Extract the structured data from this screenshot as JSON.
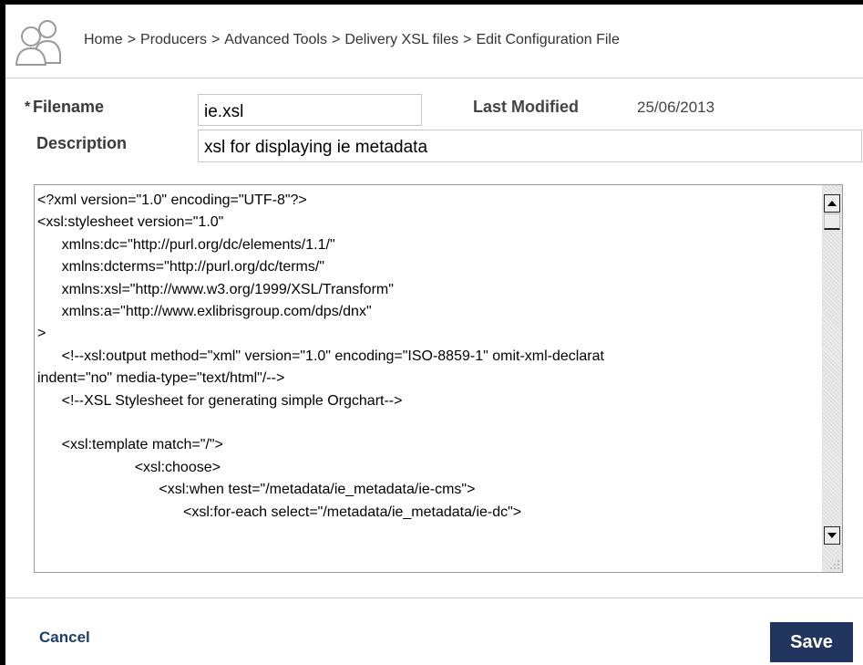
{
  "breadcrumb": {
    "items": [
      "Home",
      "Producers",
      "Advanced Tools",
      "Delivery XSL files",
      "Edit Configuration File"
    ],
    "separator": ">"
  },
  "form": {
    "required_marker": "*",
    "filename_label": "Filename",
    "filename_value": "ie.xsl",
    "last_modified_label": "Last Modified",
    "last_modified_value": "25/06/2013",
    "description_label": "Description",
    "description_value": "xsl for displaying ie metadata"
  },
  "editor": {
    "content": "<?xml version=\"1.0\" encoding=\"UTF-8\"?>\n<xsl:stylesheet version=\"1.0\"\n      xmlns:dc=\"http://purl.org/dc/elements/1.1/\"\n      xmlns:dcterms=\"http://purl.org/dc/terms/\"\n      xmlns:xsl=\"http://www.w3.org/1999/XSL/Transform\"\n      xmlns:a=\"http://www.exlibrisgroup.com/dps/dnx\"\n>\n      <!--xsl:output method=\"xml\" version=\"1.0\" encoding=\"ISO-8859-1\" omit-xml-declarat\nindent=\"no\" media-type=\"text/html\"/-->\n      <!--XSL Stylesheet for generating simple Orgchart-->\n\n      <xsl:template match=\"/\">\n                        <xsl:choose>\n                              <xsl:when test=\"/metadata/ie_metadata/ie-cms\">\n                                    <xsl:for-each select=\"/metadata/ie_metadata/ie-dc\">"
  },
  "actions": {
    "cancel_label": "Cancel",
    "save_label": "Save"
  },
  "colors": {
    "save_button_bg": "#22355f",
    "cancel_link": "#1f3c6e",
    "label_text": "#3a3a3a"
  },
  "icons": {
    "header": "people-icon",
    "scroll_up": "arrow-up-icon",
    "scroll_down": "arrow-down-icon",
    "resize": "resize-grip-icon"
  }
}
